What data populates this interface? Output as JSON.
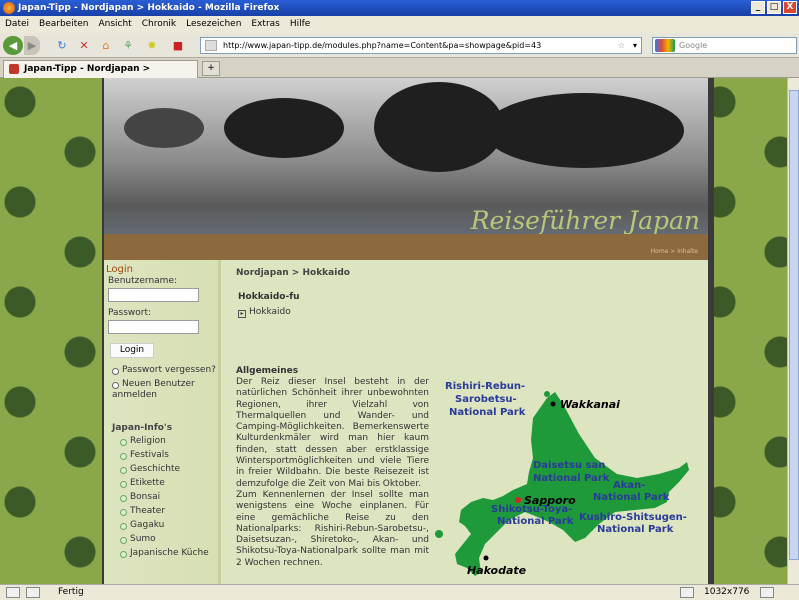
{
  "window": {
    "title": "Japan-Tipp - Nordjapan > Hokkaido - Mozilla Firefox",
    "controls": [
      "_",
      "□",
      "X"
    ]
  },
  "menu": [
    "Datei",
    "Bearbeiten",
    "Ansicht",
    "Chronik",
    "Lesezeichen",
    "Extras",
    "Hilfe"
  ],
  "nav": {
    "url": "http://www.japan-tipp.de/modules.php?name=Content&pa=showpage&pid=43",
    "search_placeholder": "Google"
  },
  "tab": {
    "label": "Japan-Tipp - Nordjapan > Hokkaido",
    "new_tab": "+"
  },
  "header": {
    "title": "Reiseführer Japan",
    "links": "Home  > Inhalte"
  },
  "sidebar": {
    "login_title": "Login",
    "username_label": "Benutzername:",
    "password_label": "Passwort:",
    "login_button": "Login",
    "forgot_password": "Passwort vergessen?",
    "new_user": "Neuen Benutzer anmelden",
    "japan_info_title": "Japan-Info's",
    "japan_info_items": [
      "Religion",
      "Festivals",
      "Geschichte",
      "Etikette",
      "Bonsai",
      "Theater",
      "Gagaku",
      "Sumo",
      "Japanische Küche"
    ]
  },
  "content": {
    "breadcrumb": "Nordjapan > Hokkaido",
    "heading": "Hokkaido-fu",
    "sublink": "Hokkaido",
    "section_title": "Allgemeines",
    "body_paragraphs": [
      "Der Reiz dieser Insel besteht in der natürlichen Schönheit ihrer unbewohnten Regionen, ihrer Vielzahl von Thermalquellen und Wander- und Camping-Möglichkeiten. Bemerkenswerte Kulturdenkmäler wird man hier kaum finden, statt dessen aber erstklassige Wintersportmöglichkeiten und viele Tiere in freier Wildbahn. Die beste Reisezeit ist demzufolge die Zeit von Mai bis Oktober.",
      "Zum Kennenlernen der Insel sollte man wenigstens eine Woche einplanen. Für eine gemächliche Reise zu den Nationalparks: Rishiri-Rebun-Sarobetsu-, Daisetsuzan-, Shiretoko-, Akan- und Shikotsu-Toya-Nationalpark sollte man mit 2 Wochen rechnen."
    ]
  },
  "map": {
    "labels": {
      "rishiri1": "Rishiri-Rebun-",
      "rishiri2": "Sarobetsu-",
      "rishiri3": "National Park",
      "wakkanai": "Wakkanai",
      "daisetsu1": "Daisetsu san",
      "daisetsu2": "National Park",
      "akan1": "Akan-",
      "akan2": "National Park",
      "sapporo": "Sapporo",
      "shikotsu1": "Shikotsu-Toya-",
      "shikotsu2": "National Park",
      "kushiro1": "Kushiro-Shitsugen-",
      "kushiro2": "National Park",
      "hakodate": "Hakodate"
    },
    "colors": {
      "land": "#1e9a3a",
      "park_text": "#2a3a9a",
      "city": "#000000",
      "capital_dot": "#e02020"
    }
  },
  "status": {
    "text": "Fertig",
    "resolution": "1032x776"
  }
}
